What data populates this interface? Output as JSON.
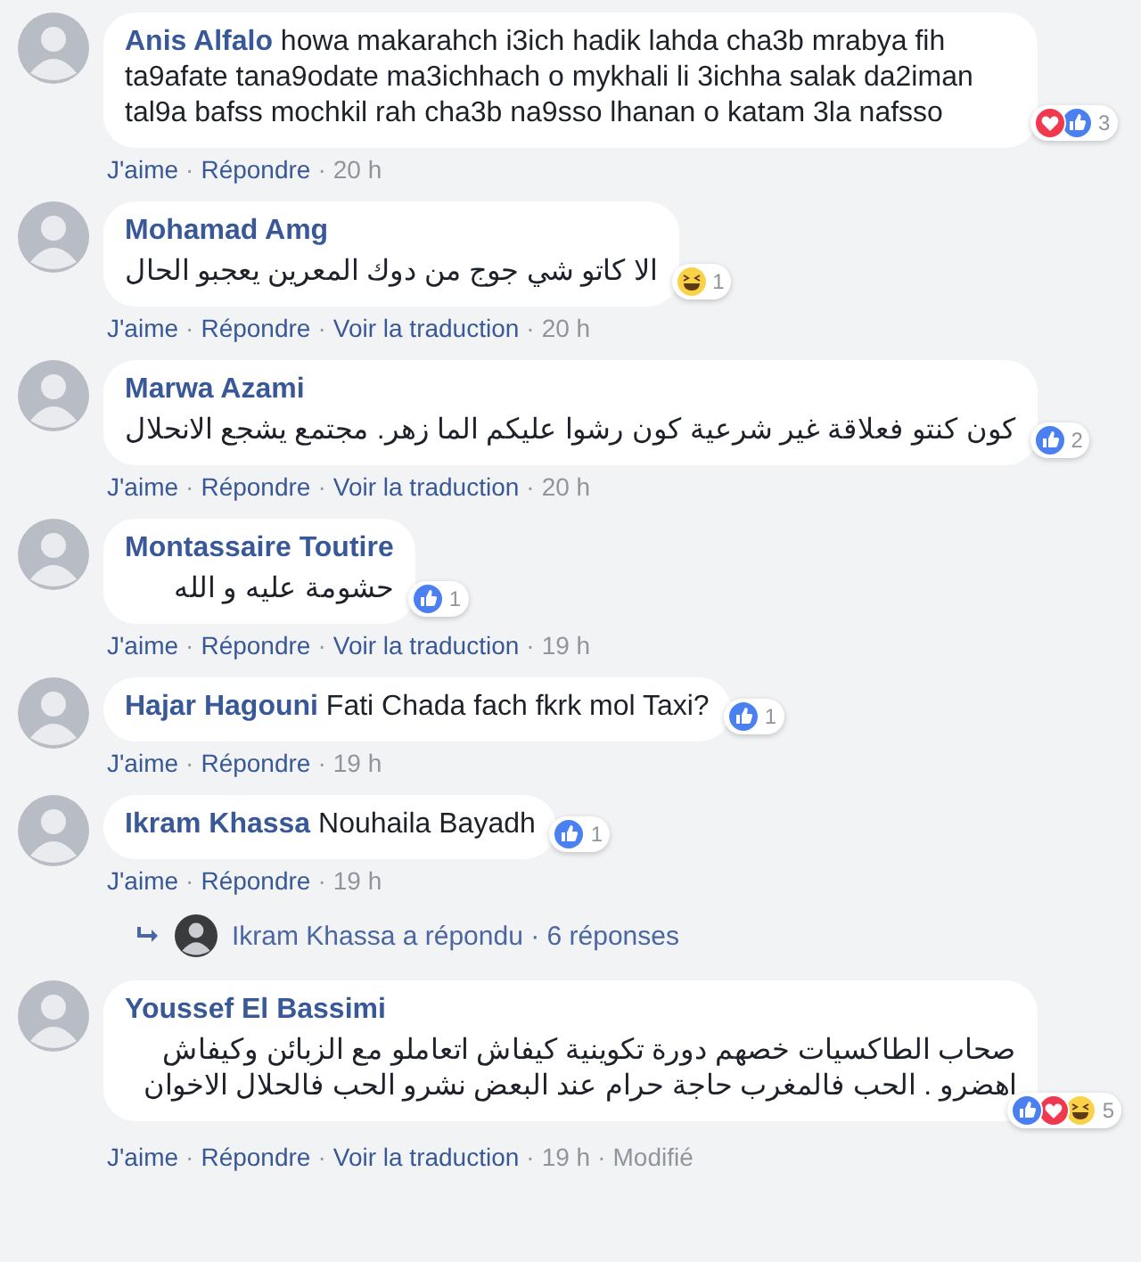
{
  "separator": "·",
  "comments": [
    {
      "name": "Anis Alfalo",
      "kind": "inline",
      "text": "howa makarahch i3ich hadik lahda cha3b mrabya fih ta9afate tana9odate ma3ichhach o mykhali li 3ichha salak da2iman tal9a bafss mochkil rah cha3b na9sso lhanan o katam 3la nafsso",
      "reactions": [
        {
          "kind": "love"
        },
        {
          "kind": "like"
        }
      ],
      "reaction_count": "3",
      "actions": [
        "J'aime",
        "Répondre"
      ],
      "time": "20 h"
    },
    {
      "name": "Mohamad Amg",
      "kind": "stacked",
      "text": "الا كاتو شي جوج من دوك المعرين يعجبو الحال",
      "reactions": [
        {
          "kind": "haha"
        }
      ],
      "reaction_count": "1",
      "actions": [
        "J'aime",
        "Répondre",
        "Voir la traduction"
      ],
      "time": "20 h"
    },
    {
      "name": "Marwa Azami",
      "kind": "stacked",
      "text": "كون كنتو فعلاقة غير شرعية كون رشوا عليكم الما زهر. مجتمع يشجع الانحلال",
      "reactions": [
        {
          "kind": "like"
        }
      ],
      "reaction_count": "2",
      "actions": [
        "J'aime",
        "Répondre",
        "Voir la traduction"
      ],
      "time": "20 h"
    },
    {
      "name": "Montassaire Toutire",
      "kind": "stacked",
      "text": "حشومة عليه و الله",
      "reactions": [
        {
          "kind": "like"
        }
      ],
      "reaction_count": "1",
      "actions": [
        "J'aime",
        "Répondre",
        "Voir la traduction"
      ],
      "time": "19 h"
    },
    {
      "name": "Hajar Hagouni",
      "kind": "inline",
      "text": "Fati Chada fach fkrk mol Taxi?",
      "reactions": [
        {
          "kind": "like"
        }
      ],
      "reaction_count": "1",
      "actions": [
        "J'aime",
        "Répondre"
      ],
      "time": "19 h"
    },
    {
      "name": "Ikram Khassa",
      "kind": "inline",
      "text": "Nouhaila Bayadh",
      "reactions": [
        {
          "kind": "like"
        }
      ],
      "reaction_count": "1",
      "actions": [
        "J'aime",
        "Répondre"
      ],
      "time": "19 h",
      "replies": {
        "text": "Ikram Khassa a répondu · 6 réponses"
      }
    },
    {
      "name": "Youssef El Bassimi",
      "kind": "stacked",
      "text": "صحاب الطاكسيات خصهم دورة تكوينية كيفاش اتعاملو مع الزبائن وكيفاش اهضرو . الحب فالمغرب حاجة حرام عند البعض نشرو الحب فالحلال الاخوان",
      "reactions": [
        {
          "kind": "like"
        },
        {
          "kind": "love"
        },
        {
          "kind": "haha"
        }
      ],
      "reaction_count": "5",
      "actions": [
        "J'aime",
        "Répondre",
        "Voir la traduction"
      ],
      "time": "19 h",
      "edited": "Modifié"
    }
  ]
}
